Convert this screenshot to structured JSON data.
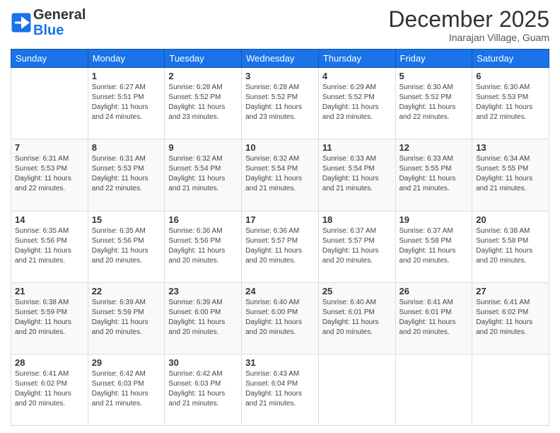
{
  "logo": {
    "line1": "General",
    "line2": "Blue"
  },
  "title": "December 2025",
  "subtitle": "Inarajan Village, Guam",
  "days_header": [
    "Sunday",
    "Monday",
    "Tuesday",
    "Wednesday",
    "Thursday",
    "Friday",
    "Saturday"
  ],
  "weeks": [
    [
      {
        "num": "",
        "info": ""
      },
      {
        "num": "1",
        "info": "Sunrise: 6:27 AM\nSunset: 5:51 PM\nDaylight: 11 hours\nand 24 minutes."
      },
      {
        "num": "2",
        "info": "Sunrise: 6:28 AM\nSunset: 5:52 PM\nDaylight: 11 hours\nand 23 minutes."
      },
      {
        "num": "3",
        "info": "Sunrise: 6:28 AM\nSunset: 5:52 PM\nDaylight: 11 hours\nand 23 minutes."
      },
      {
        "num": "4",
        "info": "Sunrise: 6:29 AM\nSunset: 5:52 PM\nDaylight: 11 hours\nand 23 minutes."
      },
      {
        "num": "5",
        "info": "Sunrise: 6:30 AM\nSunset: 5:52 PM\nDaylight: 11 hours\nand 22 minutes."
      },
      {
        "num": "6",
        "info": "Sunrise: 6:30 AM\nSunset: 5:53 PM\nDaylight: 11 hours\nand 22 minutes."
      }
    ],
    [
      {
        "num": "7",
        "info": "Sunrise: 6:31 AM\nSunset: 5:53 PM\nDaylight: 11 hours\nand 22 minutes."
      },
      {
        "num": "8",
        "info": "Sunrise: 6:31 AM\nSunset: 5:53 PM\nDaylight: 11 hours\nand 22 minutes."
      },
      {
        "num": "9",
        "info": "Sunrise: 6:32 AM\nSunset: 5:54 PM\nDaylight: 11 hours\nand 21 minutes."
      },
      {
        "num": "10",
        "info": "Sunrise: 6:32 AM\nSunset: 5:54 PM\nDaylight: 11 hours\nand 21 minutes."
      },
      {
        "num": "11",
        "info": "Sunrise: 6:33 AM\nSunset: 5:54 PM\nDaylight: 11 hours\nand 21 minutes."
      },
      {
        "num": "12",
        "info": "Sunrise: 6:33 AM\nSunset: 5:55 PM\nDaylight: 11 hours\nand 21 minutes."
      },
      {
        "num": "13",
        "info": "Sunrise: 6:34 AM\nSunset: 5:55 PM\nDaylight: 11 hours\nand 21 minutes."
      }
    ],
    [
      {
        "num": "14",
        "info": "Sunrise: 6:35 AM\nSunset: 5:56 PM\nDaylight: 11 hours\nand 21 minutes."
      },
      {
        "num": "15",
        "info": "Sunrise: 6:35 AM\nSunset: 5:56 PM\nDaylight: 11 hours\nand 20 minutes."
      },
      {
        "num": "16",
        "info": "Sunrise: 6:36 AM\nSunset: 5:56 PM\nDaylight: 11 hours\nand 20 minutes."
      },
      {
        "num": "17",
        "info": "Sunrise: 6:36 AM\nSunset: 5:57 PM\nDaylight: 11 hours\nand 20 minutes."
      },
      {
        "num": "18",
        "info": "Sunrise: 6:37 AM\nSunset: 5:57 PM\nDaylight: 11 hours\nand 20 minutes."
      },
      {
        "num": "19",
        "info": "Sunrise: 6:37 AM\nSunset: 5:58 PM\nDaylight: 11 hours\nand 20 minutes."
      },
      {
        "num": "20",
        "info": "Sunrise: 6:38 AM\nSunset: 5:58 PM\nDaylight: 11 hours\nand 20 minutes."
      }
    ],
    [
      {
        "num": "21",
        "info": "Sunrise: 6:38 AM\nSunset: 5:59 PM\nDaylight: 11 hours\nand 20 minutes."
      },
      {
        "num": "22",
        "info": "Sunrise: 6:39 AM\nSunset: 5:59 PM\nDaylight: 11 hours\nand 20 minutes."
      },
      {
        "num": "23",
        "info": "Sunrise: 6:39 AM\nSunset: 6:00 PM\nDaylight: 11 hours\nand 20 minutes."
      },
      {
        "num": "24",
        "info": "Sunrise: 6:40 AM\nSunset: 6:00 PM\nDaylight: 11 hours\nand 20 minutes."
      },
      {
        "num": "25",
        "info": "Sunrise: 6:40 AM\nSunset: 6:01 PM\nDaylight: 11 hours\nand 20 minutes."
      },
      {
        "num": "26",
        "info": "Sunrise: 6:41 AM\nSunset: 6:01 PM\nDaylight: 11 hours\nand 20 minutes."
      },
      {
        "num": "27",
        "info": "Sunrise: 6:41 AM\nSunset: 6:02 PM\nDaylight: 11 hours\nand 20 minutes."
      }
    ],
    [
      {
        "num": "28",
        "info": "Sunrise: 6:41 AM\nSunset: 6:02 PM\nDaylight: 11 hours\nand 20 minutes."
      },
      {
        "num": "29",
        "info": "Sunrise: 6:42 AM\nSunset: 6:03 PM\nDaylight: 11 hours\nand 21 minutes."
      },
      {
        "num": "30",
        "info": "Sunrise: 6:42 AM\nSunset: 6:03 PM\nDaylight: 11 hours\nand 21 minutes."
      },
      {
        "num": "31",
        "info": "Sunrise: 6:43 AM\nSunset: 6:04 PM\nDaylight: 11 hours\nand 21 minutes."
      },
      {
        "num": "",
        "info": ""
      },
      {
        "num": "",
        "info": ""
      },
      {
        "num": "",
        "info": ""
      }
    ]
  ]
}
